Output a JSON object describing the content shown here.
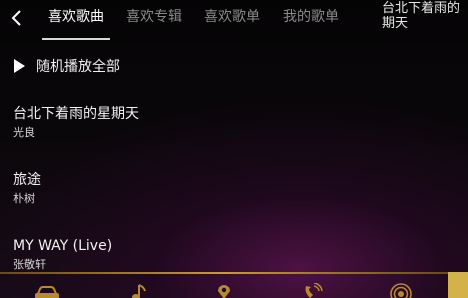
{
  "header": {
    "tabs": [
      {
        "label": "喜欢歌曲",
        "active": true
      },
      {
        "label": "喜欢专辑",
        "active": false
      },
      {
        "label": "喜欢歌单",
        "active": false
      },
      {
        "label": "我的歌单",
        "active": false
      }
    ],
    "now_playing_line1": "台北下着雨的",
    "now_playing_line2": "期天"
  },
  "play_all": {
    "label": "随机播放全部",
    "icon": "play-icon"
  },
  "songs": [
    {
      "title": "台北下着雨的星期天",
      "artist": "光良"
    },
    {
      "title": "旅途",
      "artist": "朴树"
    },
    {
      "title": "MY WAY (Live)",
      "artist": "张敬轩"
    }
  ],
  "dock": {
    "icons": [
      "car-icon",
      "music-note-icon",
      "map-pin-icon",
      "phone-icon",
      "radio-icon"
    ],
    "accent_color": "#d4b24a",
    "line_color": "#c89a3a"
  }
}
